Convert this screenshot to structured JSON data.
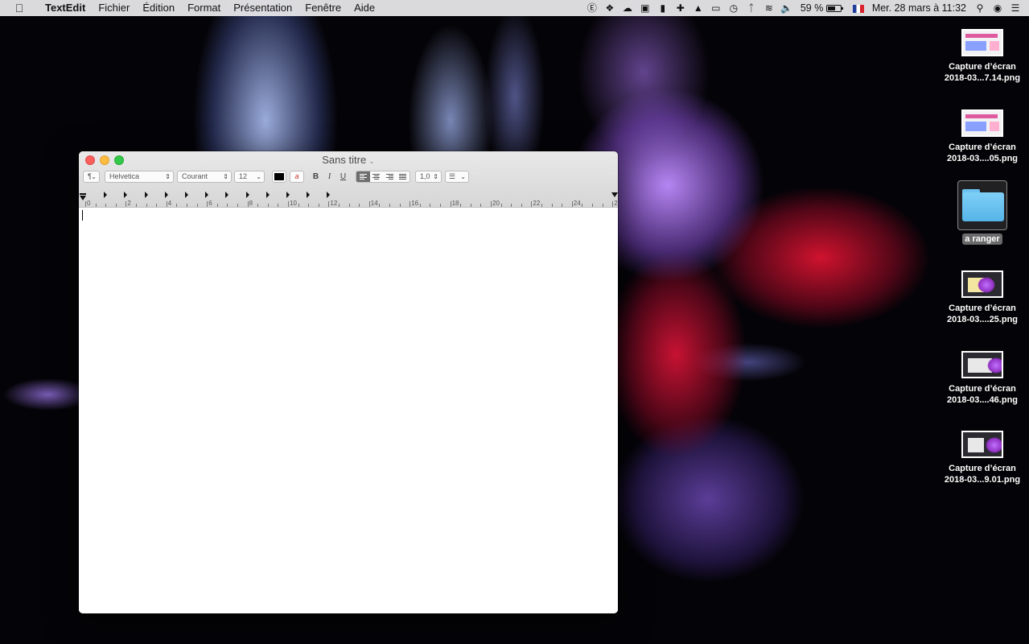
{
  "menubar": {
    "app_name": "TextEdit",
    "items": [
      "Fichier",
      "Édition",
      "Format",
      "Présentation",
      "Fenêtre",
      "Aide"
    ],
    "status_icons": [
      "1password-icon",
      "dropbox-icon",
      "creative-cloud-icon",
      "reader-icon",
      "bookmark-icon",
      "plus-icon",
      "upload-icon",
      "airplay-icon",
      "time-machine-icon",
      "bluetooth-icon",
      "wifi-icon",
      "volume-icon"
    ],
    "battery": "59 %",
    "battery_level": 0.59,
    "datetime": "Mer. 28 mars à  11:32"
  },
  "window": {
    "title": "Sans titre",
    "format_bar": {
      "paragraph_style": "¶",
      "font_family": "Helvetica",
      "font_style": "Courant",
      "font_size": "12",
      "bold_label": "B",
      "italic_label": "I",
      "underline_label": "U",
      "line_spacing": "1,0",
      "text_color": "#000000"
    },
    "ruler_numbers": [
      "0",
      "2",
      "4",
      "6",
      "8",
      "10",
      "12",
      "14",
      "16",
      "18",
      "20",
      "22",
      "24",
      "26"
    ]
  },
  "desktop": {
    "icons": [
      {
        "label_line1": "Capture d’écran",
        "label_line2": "2018-03...7.14.png"
      },
      {
        "label_line1": "Capture d’écran",
        "label_line2": "2018-03....05.png"
      },
      {
        "label_line1": "a ranger"
      },
      {
        "label_line1": "Capture d’écran",
        "label_line2": "2018-03....25.png"
      },
      {
        "label_line1": "Capture d’écran",
        "label_line2": "2018-03....46.png"
      },
      {
        "label_line1": "Capture d’écran",
        "label_line2": "2018-03...9.01.png"
      }
    ]
  }
}
